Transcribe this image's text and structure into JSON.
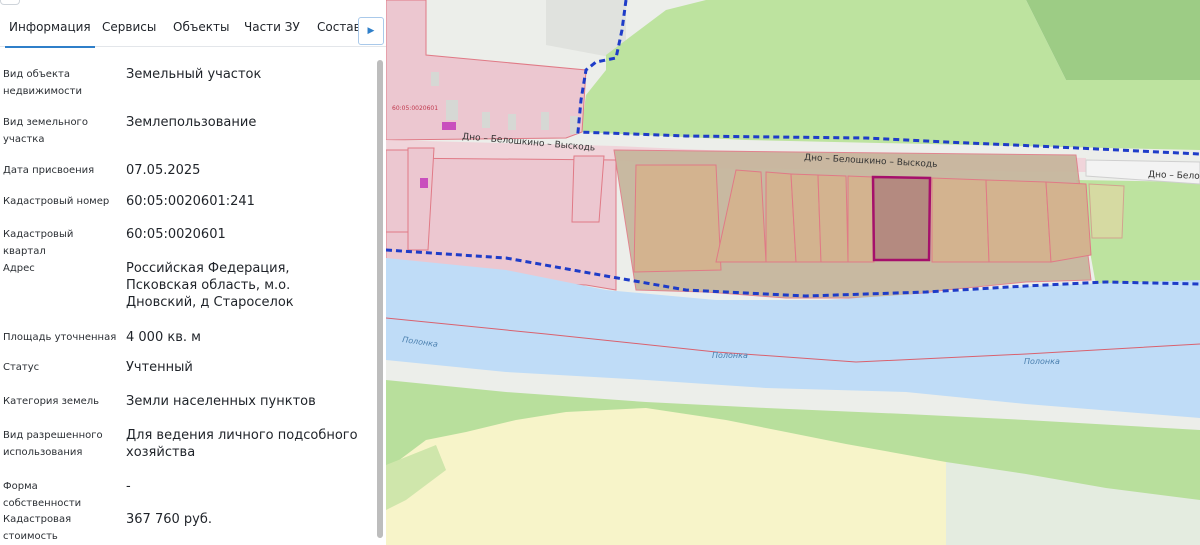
{
  "tabs": [
    {
      "label": "Информация",
      "active": true
    },
    {
      "label": "Сервисы",
      "active": false
    },
    {
      "label": "Объекты",
      "active": false
    },
    {
      "label": "Части ЗУ",
      "active": false
    },
    {
      "label": "Состав",
      "active": false
    }
  ],
  "info": {
    "object_type": {
      "label": "Вид объекта недвижимости",
      "value": "Земельный участок"
    },
    "land_type": {
      "label": "Вид земельного участка",
      "value": "Землепользование"
    },
    "assigned_date": {
      "label": "Дата присвоения",
      "value": "07.05.2025"
    },
    "cadastral_number": {
      "label": "Кадастровый номер",
      "value": "60:05:0020601:241"
    },
    "cadastral_quarter": {
      "label": "Кадастровый квартал",
      "value": "60:05:0020601"
    },
    "address": {
      "label": "Адрес",
      "value": "Российская Федерация, Псковская область, м.о. Дновский, д Староселок"
    },
    "area": {
      "label": "Площадь уточненная",
      "value": "4 000 кв. м"
    },
    "status": {
      "label": "Статус",
      "value": "Учтенный"
    },
    "land_category": {
      "label": "Категория земель",
      "value": "Земли населенных пунктов"
    },
    "permitted_use": {
      "label": "Вид разрешенного использования",
      "value": "Для ведения личного подсобного хозяйства"
    },
    "ownership": {
      "label": "Форма собственности",
      "value": "-"
    },
    "cadastral_value": {
      "label": "Кадастровая стоимость",
      "value": "367 760 руб."
    }
  },
  "map": {
    "road_labels": [
      "Дно – Белошкино – Выскодь",
      "Дно – Белошкино – Выскодь",
      "Дно – Бело"
    ],
    "river_labels": [
      "Полонка",
      "Полонка",
      "Полонка"
    ],
    "quarter_label": "60:05:0020601",
    "colors": {
      "settlement_fill": "#ecc7d0",
      "settlement_border": "#e07a86",
      "forest": "#b9e09a",
      "forest_dark": "#a3d487",
      "river": "#bfdcf7",
      "field": "#f6f3c7",
      "selected_parcel": "#a5106b",
      "boundary_dash": "#1e3cc8"
    }
  }
}
